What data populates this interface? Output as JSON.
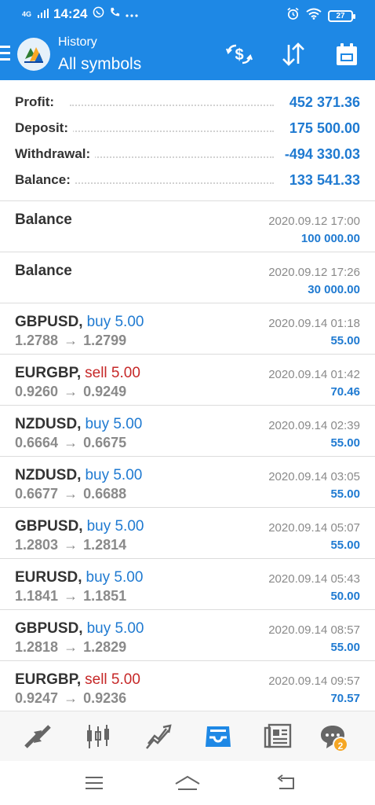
{
  "status_bar": {
    "network": "4G",
    "time": "14:24",
    "battery": "27"
  },
  "header": {
    "subtitle": "History",
    "title": "All symbols"
  },
  "summary": {
    "profit_label": "Profit:",
    "profit_value": "452 371.36",
    "deposit_label": "Deposit:",
    "deposit_value": "175 500.00",
    "withdrawal_label": "Withdrawal:",
    "withdrawal_value": "-494 330.03",
    "balance_label": "Balance:",
    "balance_value": "133 541.33"
  },
  "deals": [
    {
      "title": "Balance",
      "time": "2020.09.12 17:00",
      "amount": "100 000.00"
    },
    {
      "title": "Balance",
      "time": "2020.09.12 17:26",
      "amount": "30 000.00"
    },
    {
      "symbol": "GBPUSD",
      "side": "buy 5.00",
      "side_type": "buy",
      "open": "1.2788",
      "close": "1.2799",
      "time": "2020.09.14 01:18",
      "amount": "55.00"
    },
    {
      "symbol": "EURGBP",
      "side": "sell 5.00",
      "side_type": "sell",
      "open": "0.9260",
      "close": "0.9249",
      "time": "2020.09.14 01:42",
      "amount": "70.46"
    },
    {
      "symbol": "NZDUSD",
      "side": "buy 5.00",
      "side_type": "buy",
      "open": "0.6664",
      "close": "0.6675",
      "time": "2020.09.14 02:39",
      "amount": "55.00"
    },
    {
      "symbol": "NZDUSD",
      "side": "buy 5.00",
      "side_type": "buy",
      "open": "0.6677",
      "close": "0.6688",
      "time": "2020.09.14 03:05",
      "amount": "55.00"
    },
    {
      "symbol": "GBPUSD",
      "side": "buy 5.00",
      "side_type": "buy",
      "open": "1.2803",
      "close": "1.2814",
      "time": "2020.09.14 05:07",
      "amount": "55.00"
    },
    {
      "symbol": "EURUSD",
      "side": "buy 5.00",
      "side_type": "buy",
      "open": "1.1841",
      "close": "1.1851",
      "time": "2020.09.14 05:43",
      "amount": "50.00"
    },
    {
      "symbol": "GBPUSD",
      "side": "buy 5.00",
      "side_type": "buy",
      "open": "1.2818",
      "close": "1.2829",
      "time": "2020.09.14 08:57",
      "amount": "55.00"
    },
    {
      "symbol": "EURGBP",
      "side": "sell 5.00",
      "side_type": "sell",
      "open": "0.9247",
      "close": "0.9236",
      "time": "2020.09.14 09:57",
      "amount": "70.57"
    }
  ],
  "bottom_nav": {
    "items": [
      "quotes-icon",
      "chart-icon",
      "trade-icon",
      "history-icon",
      "news-icon",
      "chat-icon"
    ],
    "active": "history-icon",
    "chat_badge": "2"
  },
  "colors": {
    "primary": "#1e88e5",
    "value_blue": "#1f7ad1",
    "sell_red": "#c62828",
    "badge_orange": "#f5a623"
  }
}
